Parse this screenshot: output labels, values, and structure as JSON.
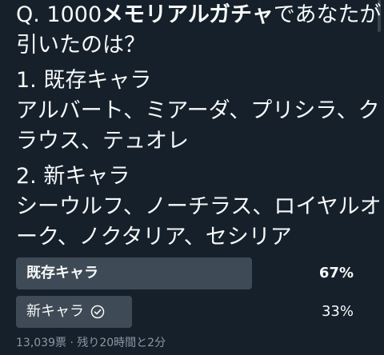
{
  "colors": {
    "background": "#15202b",
    "text": "#f7f9f9",
    "bar": "#3e4a55",
    "muted": "#8b98a5"
  },
  "tweet": {
    "line1_prefix": "Q. 1000",
    "line1_bold": "メモリアルガチャ",
    "line1_suffix": "であなたが",
    "line2": "引いたのは？",
    "line3": "1. 既存キャラ",
    "line4": "アルバート、ミアーダ、プリシラ、ク",
    "line5": "ラウス、テュオレ",
    "line6": "2. 新キャラ",
    "line7": "シーウルフ、ノーチラス、ロイヤルオ",
    "line8": "ーク、ノクタリア、セシリア"
  },
  "poll": {
    "options": [
      {
        "label": "既存キャラ",
        "percent_text": "67%",
        "percent": 67,
        "winner": true,
        "voted": false
      },
      {
        "label": "新キャラ",
        "percent_text": "33%",
        "percent": 33,
        "winner": false,
        "voted": true,
        "icon": "check-circle-icon"
      }
    ],
    "votes": "13,039票",
    "separator": "·",
    "remaining": "残り20時間と2分"
  }
}
